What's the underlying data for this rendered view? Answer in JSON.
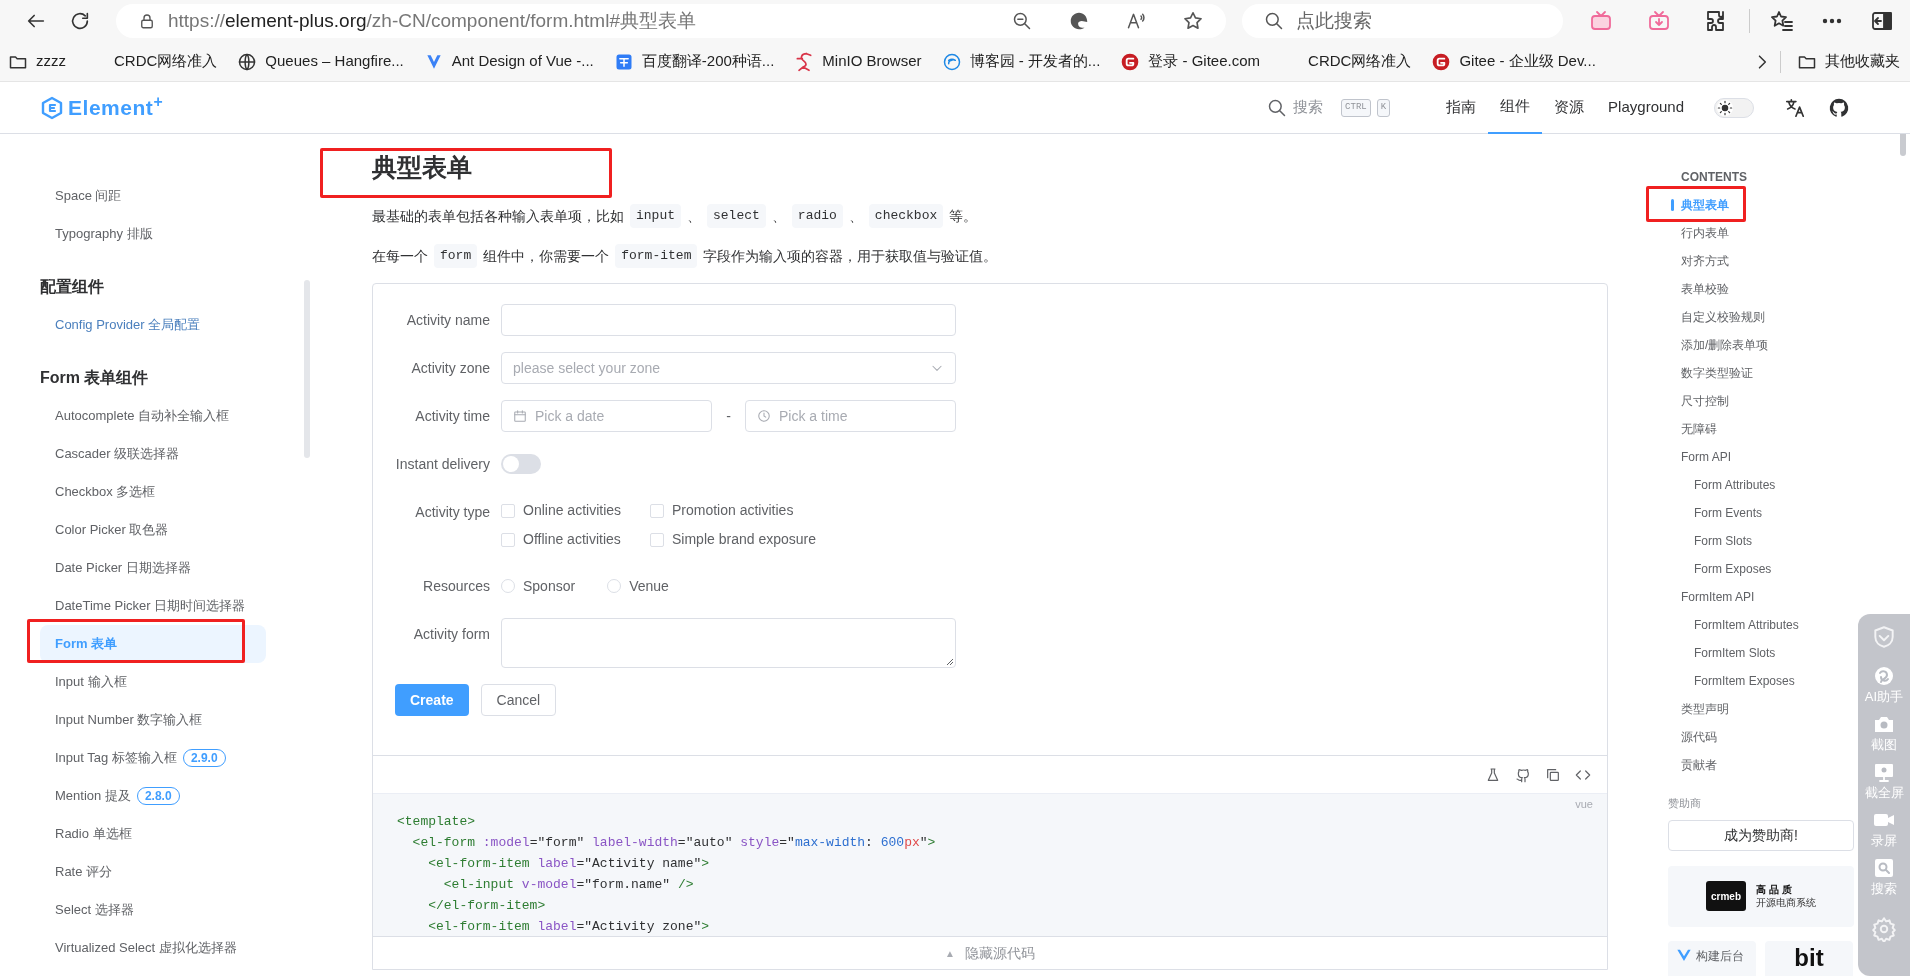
{
  "browser": {
    "url": {
      "scheme": "https://",
      "host": "element-plus.org",
      "path": "/zh-CN/component/form.html#典型表单"
    },
    "search": {
      "placeholder": "点此搜索"
    },
    "bookmarks": [
      {
        "label": "zzzz",
        "kind": "folder"
      },
      {
        "label": "CRDC网络准入",
        "kind": "blank"
      },
      {
        "label": "Queues – Hangfire...",
        "kind": "globe"
      },
      {
        "label": "Ant Design of Vue -...",
        "kind": "antd"
      },
      {
        "label": "百度翻译-200种语...",
        "kind": "translate"
      },
      {
        "label": "MinIO Browser",
        "kind": "minio"
      },
      {
        "label": "博客园 - 开发者的...",
        "kind": "cnblogs"
      },
      {
        "label": "登录 - Gitee.com",
        "kind": "gitee"
      },
      {
        "label": "CRDC网络准入",
        "kind": "blank"
      },
      {
        "label": "Gitee - 企业级 Dev...",
        "kind": "gitee"
      }
    ],
    "other_bookmarks": "其他收藏夹"
  },
  "header": {
    "logo": "Element$^{+}$",
    "theme_dark": false,
    "search": "搜索",
    "keys": [
      "CTRL",
      "K"
    ],
    "nav": [
      {
        "label": "指南",
        "selected": false
      },
      {
        "label": "组件",
        "selected": true
      },
      {
        "label": "资源",
        "selected": false
      },
      {
        "label": "Playground",
        "selected": false
      }
    ]
  },
  "sidebar": {
    "sections": [
      {
        "items": [
          {
            "label": "Space 间距",
            "selected": false,
            "hovered": false
          },
          {
            "label": "Typography 排版",
            "selected": false,
            "hovered": false
          }
        ]
      },
      {
        "heading": "配置组件",
        "items": [
          {
            "label": "Config Provider 全局配置",
            "selected": false,
            "hovered": true
          }
        ]
      },
      {
        "heading": "Form 表单组件",
        "items": [
          {
            "label": "Autocomplete 自动补全输入框",
            "selected": false,
            "hovered": false
          },
          {
            "label": "Cascader 级联选择器",
            "selected": false,
            "hovered": false
          },
          {
            "label": "Checkbox 多选框",
            "selected": false,
            "hovered": false
          },
          {
            "label": "Color Picker 取色器",
            "selected": false,
            "hovered": false
          },
          {
            "label": "Date Picker 日期选择器",
            "selected": false,
            "hovered": false
          },
          {
            "label": "DateTime Picker 日期时间选择器",
            "selected": false,
            "hovered": false
          },
          {
            "label": "Form 表单",
            "selected": true,
            "hovered": false
          },
          {
            "label": "Input 输入框",
            "selected": false,
            "hovered": false
          },
          {
            "label": "Input Number 数字输入框",
            "selected": false,
            "hovered": false
          },
          {
            "label": "Input Tag 标签输入框",
            "selected": false,
            "hovered": false,
            "badge": "2.9.0"
          },
          {
            "label": "Mention 提及",
            "selected": false,
            "hovered": false,
            "badge": "2.8.0"
          },
          {
            "label": "Radio 单选框",
            "selected": false,
            "hovered": false
          },
          {
            "label": "Rate 评分",
            "selected": false,
            "hovered": false
          },
          {
            "label": "Select 选择器",
            "selected": false,
            "hovered": false
          },
          {
            "label": "Virtualized Select 虚拟化选择器",
            "selected": false,
            "hovered": false
          }
        ]
      }
    ]
  },
  "doc": {
    "title": "典型表单",
    "paragraphs": [
      [
        {
          "text": "最基础的表单包括各种输入表单项，比如",
          "code": false
        },
        {
          "text": "input",
          "code": true
        },
        {
          "text": "、",
          "code": false
        },
        {
          "text": "select",
          "code": true
        },
        {
          "text": "、",
          "code": false
        },
        {
          "text": "radio",
          "code": true
        },
        {
          "text": "、",
          "code": false
        },
        {
          "text": "checkbox",
          "code": true
        },
        {
          "text": "等。",
          "code": false
        }
      ],
      [
        {
          "text": "在每一个",
          "code": false
        },
        {
          "text": "form",
          "code": true
        },
        {
          "text": "组件中，你需要一个",
          "code": false
        },
        {
          "text": "form-item",
          "code": true
        },
        {
          "text": "字段作为输入项的容器，用于获取值与验证值。",
          "code": false
        }
      ]
    ]
  },
  "form": {
    "rows": [
      {
        "kind": "input",
        "label": "Activity name"
      },
      {
        "kind": "select",
        "label": "Activity zone",
        "placeholder": "please select your zone"
      },
      {
        "kind": "datetime",
        "label": "Activity time",
        "date_placeholder": "Pick a date",
        "separator": "-",
        "time_placeholder": "Pick a time"
      },
      {
        "kind": "switch",
        "label": "Instant delivery",
        "on": false
      },
      {
        "kind": "checkboxes",
        "label": "Activity type",
        "options": [
          {
            "label": "Online activities",
            "checked": false
          },
          {
            "label": "Promotion activities",
            "checked": false
          },
          {
            "label": "Offline activities",
            "checked": false
          },
          {
            "label": "Simple brand exposure",
            "checked": false
          }
        ]
      },
      {
        "kind": "radios",
        "label": "Resources",
        "options": [
          {
            "label": "Sponsor",
            "selected": false
          },
          {
            "label": "Venue",
            "selected": false
          }
        ]
      },
      {
        "kind": "textarea",
        "label": "Activity form"
      }
    ],
    "buttons": [
      {
        "label": "Create",
        "primary": true
      },
      {
        "label": "Cancel",
        "primary": false
      }
    ]
  },
  "code": {
    "language": "vue",
    "lines": [
      [
        {
          "text": "<template>",
          "kind": "tag"
        }
      ],
      [
        {
          "text": "  <el-form",
          "kind": "tag"
        },
        {
          "text": " :model",
          "kind": "attr"
        },
        {
          "text": "=\"form\"",
          "kind": "str"
        },
        {
          "text": " label-width",
          "kind": "attr"
        },
        {
          "text": "=\"auto\"",
          "kind": "str"
        },
        {
          "text": " style",
          "kind": "attr"
        },
        {
          "text": "=\"",
          "kind": "str"
        },
        {
          "text": "max-width",
          "kind": "prop"
        },
        {
          "text": ": ",
          "kind": "str"
        },
        {
          "text": "600",
          "kind": "num"
        },
        {
          "text": "px",
          "kind": "unit"
        },
        {
          "text": "\"",
          "kind": "str"
        },
        {
          "text": ">",
          "kind": "tag"
        }
      ],
      [
        {
          "text": "    <el-form-item",
          "kind": "tag"
        },
        {
          "text": " label",
          "kind": "attr"
        },
        {
          "text": "=\"Activity name\"",
          "kind": "str"
        },
        {
          "text": ">",
          "kind": "tag"
        }
      ],
      [
        {
          "text": "      <el-input",
          "kind": "tag"
        },
        {
          "text": " v-model",
          "kind": "attr"
        },
        {
          "text": "=\"form.name\"",
          "kind": "str"
        },
        {
          "text": " />",
          "kind": "tag"
        }
      ],
      [
        {
          "text": "    </el-form-item>",
          "kind": "tag"
        }
      ],
      [
        {
          "text": "    <el-form-item",
          "kind": "tag"
        },
        {
          "text": " label",
          "kind": "attr"
        },
        {
          "text": "=\"Activity zone\"",
          "kind": "str"
        },
        {
          "text": ">",
          "kind": "tag"
        }
      ]
    ],
    "toggle_icon": "▲",
    "toggle": "隐藏源代码"
  },
  "toc": {
    "title": "CONTENTS",
    "items": [
      {
        "label": "典型表单",
        "selected": true
      },
      {
        "label": "行内表单",
        "selected": false
      },
      {
        "label": "对齐方式",
        "selected": false
      },
      {
        "label": "表单校验",
        "selected": false
      },
      {
        "label": "自定义校验规则",
        "selected": false
      },
      {
        "label": "添加/删除表单项",
        "selected": false
      },
      {
        "label": "数字类型验证",
        "selected": false
      },
      {
        "label": "尺寸控制",
        "selected": false
      },
      {
        "label": "无障碍",
        "selected": false
      },
      {
        "label": "Form API",
        "selected": false,
        "children": [
          {
            "label": "Form Attributes",
            "selected": false
          },
          {
            "label": "Form Events",
            "selected": false
          },
          {
            "label": "Form Slots",
            "selected": false
          },
          {
            "label": "Form Exposes",
            "selected": false
          }
        ]
      },
      {
        "label": "FormItem API",
        "selected": false,
        "children": [
          {
            "label": "FormItem Attributes",
            "selected": false
          },
          {
            "label": "FormItem Slots",
            "selected": false
          },
          {
            "label": "FormItem Exposes",
            "selected": false
          }
        ]
      },
      {
        "label": "类型声明",
        "selected": false
      },
      {
        "label": "源代码",
        "selected": false
      },
      {
        "label": "贡献者",
        "selected": false
      }
    ]
  },
  "sponsors": {
    "heading": "赞助商",
    "button": "成为赞助商!",
    "cards": [
      {
        "kind": "logo-text",
        "logo": "crmeb",
        "lines": [
          "高 品 质",
          "开源电商系统"
        ]
      },
      {
        "kind": "icon-text",
        "text": "构建后台"
      },
      {
        "kind": "wordmark",
        "text": "bit"
      }
    ]
  },
  "float_toolbar": {
    "items": [
      {
        "kind": "shield"
      },
      {
        "kind": "ai",
        "label": "AI助手"
      },
      {
        "kind": "camera",
        "label": "截图"
      },
      {
        "kind": "screen",
        "label": "截全屏"
      },
      {
        "kind": "video",
        "label": "录屏"
      },
      {
        "kind": "search",
        "label": "搜索"
      },
      {
        "kind": "gear"
      }
    ]
  }
}
